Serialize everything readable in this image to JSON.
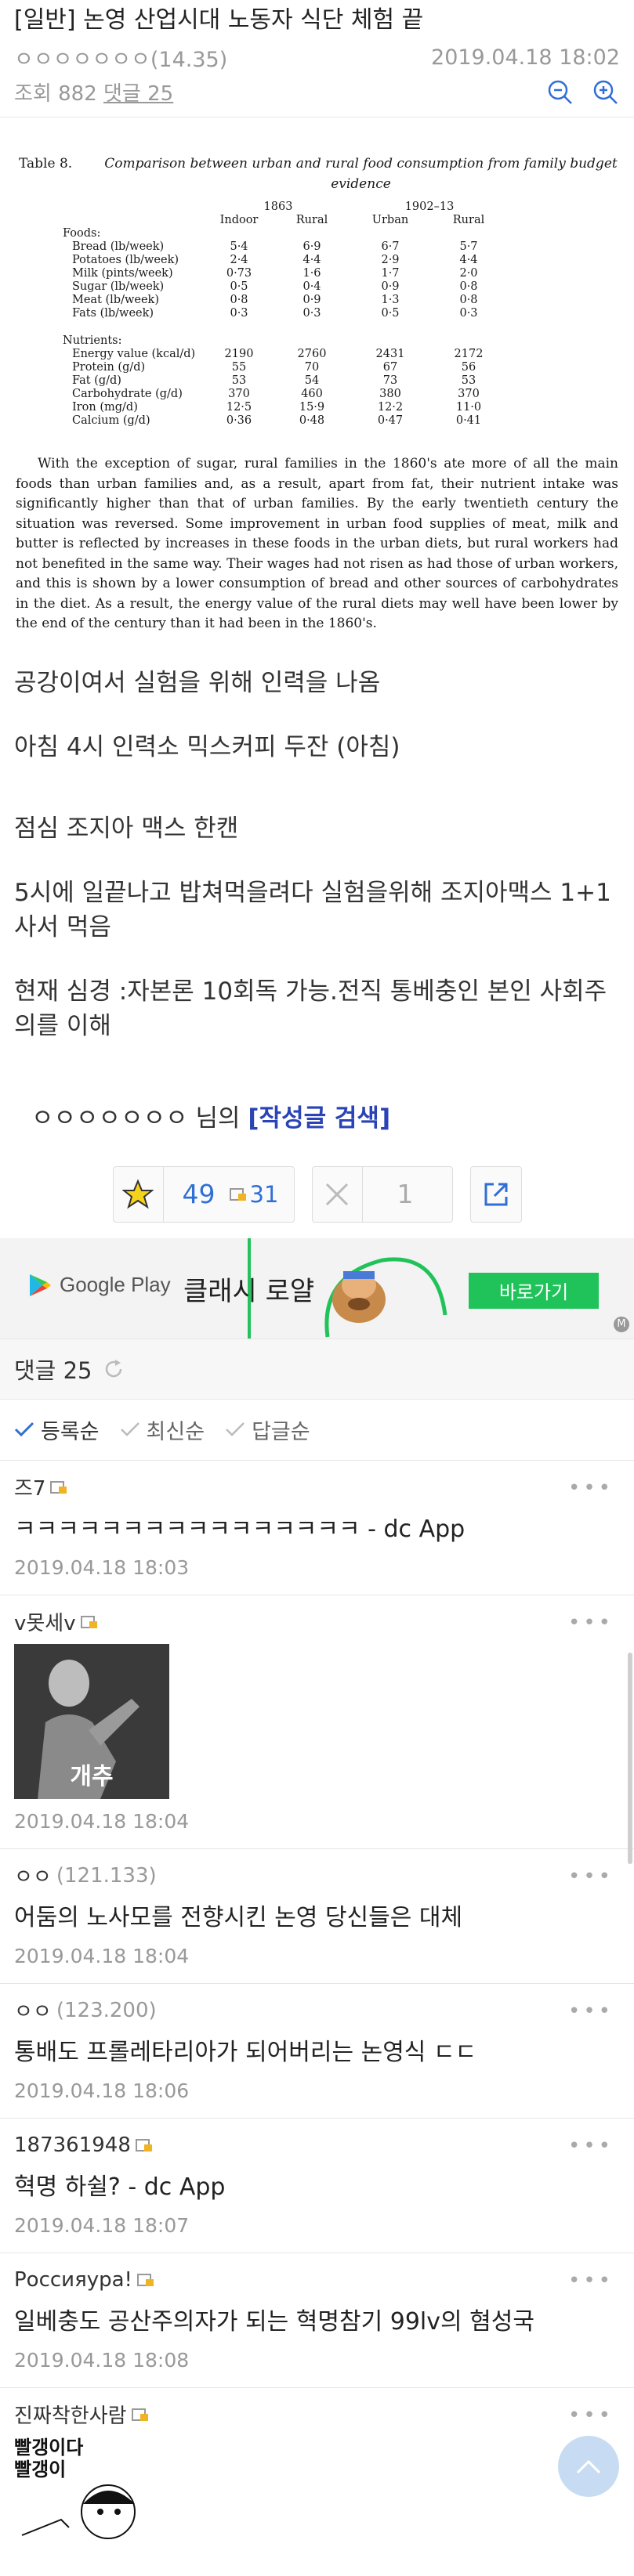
{
  "post": {
    "title": "[일반] 논영 산업시대 노동자 식단 체험 끝",
    "author": "ㅇㅇㅇㅇㅇㅇㅇ",
    "ip": "(14.35)",
    "datetime": "2019.04.18 18:02",
    "views_label": "조회 882",
    "comments_label": "댓글 25"
  },
  "paper": {
    "table_label": "Table 8.",
    "table_title": "Comparison between urban and rural food consumption from family budget evidence",
    "year_a": "1863",
    "year_b": "1902–13",
    "col_indoor": "Indoor",
    "col_rural1": "Rural",
    "col_urban": "Urban",
    "col_rural2": "Rural",
    "foods_label": "Foods:",
    "nutrients_label": "Nutrients:",
    "foods": [
      {
        "name": "Bread (lb/week)",
        "v": [
          "5·4",
          "6·9",
          "6·7",
          "5·7"
        ]
      },
      {
        "name": "Potatoes (lb/week)",
        "v": [
          "2·4",
          "4·4",
          "2·9",
          "4·4"
        ]
      },
      {
        "name": "Milk (pints/week)",
        "v": [
          "0·73",
          "1·6",
          "1·7",
          "2·0"
        ]
      },
      {
        "name": "Sugar (lb/week)",
        "v": [
          "0·5",
          "0·4",
          "0·9",
          "0·8"
        ]
      },
      {
        "name": "Meat (lb/week)",
        "v": [
          "0·8",
          "0·9",
          "1·3",
          "0·8"
        ]
      },
      {
        "name": "Fats (lb/week)",
        "v": [
          "0·3",
          "0·3",
          "0·5",
          "0·3"
        ]
      }
    ],
    "nutrients": [
      {
        "name": "Energy value (kcal/d)",
        "v": [
          "2190",
          "2760",
          "2431",
          "2172"
        ]
      },
      {
        "name": "Protein (g/d)",
        "v": [
          "55",
          "70",
          "67",
          "56"
        ]
      },
      {
        "name": "Fat (g/d)",
        "v": [
          "53",
          "54",
          "73",
          "53"
        ]
      },
      {
        "name": "Carbohydrate (g/d)",
        "v": [
          "370",
          "460",
          "380",
          "370"
        ]
      },
      {
        "name": "Iron (mg/d)",
        "v": [
          "12·5",
          "15·9",
          "12·2",
          "11·0"
        ]
      },
      {
        "name": "Calcium (g/d)",
        "v": [
          "0·36",
          "0·48",
          "0·47",
          "0·41"
        ]
      }
    ],
    "paragraph": "With the exception of sugar, rural families in the 1860's ate more of all the main foods than urban families and, as a result, apart from fat, their nutrient intake was significantly higher than that of urban families. By the early twentieth century the situation was reversed. Some improvement in urban food supplies of meat, milk and butter is reflected by increases in these foods in the urban diets, but rural workers had not benefited in the same way. Their wages had not risen as had those of urban workers, and this is shown by a lower consumption of bread and other sources of carbohydrates in the diet. As a result, the energy value of the rural diets may well have been lower by the end of the century than it had been in the 1860's."
  },
  "body": {
    "p1": "공강이여서 실험을 위해 인력을 나옴",
    "p2": "아침 4시 인력소 믹스커피 두잔 (아침)",
    "p3": "점심 조지아 맥스 한캔",
    "p4": "5시에 일끝나고 밥쳐먹을려다 실험을위해 조지아맥스 1+1 사서 먹음",
    "p5": "현재 심경 :자본론 10회독 가능.전직 통베충인 본인 사회주의를 이해"
  },
  "author_search": {
    "name": "ㅇㅇㅇㅇㅇㅇㅇ",
    "suffix": " 님의 ",
    "link": "[작성글 검색]"
  },
  "votes": {
    "up": "49",
    "fixed": "31",
    "down": "1"
  },
  "ad": {
    "store": "Google Play",
    "title": "클래시 로얄",
    "button": "바로가기",
    "badge": "M"
  },
  "comments_header": {
    "label": "댓글 25"
  },
  "sort": {
    "registered": "등록순",
    "latest": "최신순",
    "reply": "답글순"
  },
  "comments": [
    {
      "name": "즈7",
      "ip": "",
      "text": "ㅋㅋㅋㅋㅋㅋㅋㅋㅋㅋㅋㅋㅋㅋㅋㅋ - dc App",
      "date": "2019.04.18 18:03",
      "fixed": true
    },
    {
      "name": "v못세v",
      "ip": "",
      "text": "",
      "image_caption": "개추",
      "date": "2019.04.18 18:04",
      "fixed": true
    },
    {
      "name": "ㅇㅇ",
      "ip": "(121.133)",
      "text": "어둠의 노사모를 전향시킨 논영 당신들은 대체",
      "date": "2019.04.18 18:04",
      "fixed": false
    },
    {
      "name": "ㅇㅇ",
      "ip": "(123.200)",
      "text": "통배도 프롤레타리아가 되어버리는 논영식 ㄷㄷ",
      "date": "2019.04.18 18:06",
      "fixed": false
    },
    {
      "name": "187361948",
      "ip": "",
      "text": "혁명 하쉴? - dc App",
      "date": "2019.04.18 18:07",
      "fixed": true
    },
    {
      "name": "Россияура!",
      "ip": "",
      "text": "일베충도 공산주의자가 되는 혁명참기 99lv의 혐성국",
      "date": "2019.04.18 18:08",
      "fixed": true
    },
    {
      "name": "진짜착한사람",
      "ip": "",
      "dccon_text": "빨갱이다\n빨갱이",
      "fixed": true
    }
  ],
  "colors": {
    "link_blue": "#2a43b5",
    "vote_blue": "#2f6fd6",
    "ad_green": "#1fc35a"
  }
}
